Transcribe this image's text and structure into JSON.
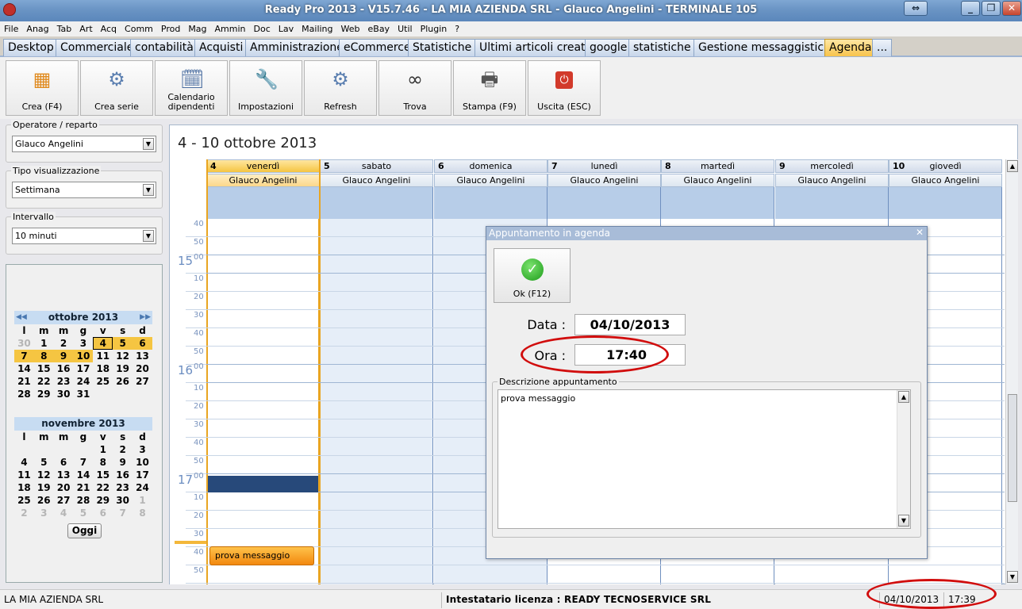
{
  "window": {
    "title": "Ready Pro 2013 - V15.7.46 - LA MIA AZIENDA SRL - Glauco Angelini - TERMINALE 105",
    "buttons": {
      "restore_alt": "⇔",
      "minimize": "_",
      "maximize": "❐",
      "close": "✕"
    }
  },
  "menu": [
    "File",
    "Anag",
    "Tab",
    "Art",
    "Acq",
    "Comm",
    "Prod",
    "Mag",
    "Ammin",
    "Doc",
    "Lav",
    "Mailing",
    "Web",
    "eBay",
    "Util",
    "Plugin",
    "?"
  ],
  "tabs": [
    {
      "label": "Desktop"
    },
    {
      "label": "Commerciale"
    },
    {
      "label": "contabilità"
    },
    {
      "label": "Acquisti"
    },
    {
      "label": "Amministrazione"
    },
    {
      "label": "eCommerce"
    },
    {
      "label": "Statistiche"
    },
    {
      "label": "Ultimi articoli creati"
    },
    {
      "label": "google"
    },
    {
      "label": "statistiche"
    },
    {
      "label": "Gestione messaggistica"
    },
    {
      "label": "Agenda",
      "active": true
    },
    {
      "label": "..."
    }
  ],
  "toolbar": [
    {
      "label": "Crea (F4)",
      "icon": "grid-add-icon"
    },
    {
      "label": "Crea serie",
      "icon": "gear-doc-icon"
    },
    {
      "label": "Calendario dipendenti",
      "icon": "calendar-clock-icon"
    },
    {
      "label": "Impostazioni",
      "icon": "wrench-icon"
    },
    {
      "label": "Refresh",
      "icon": "refresh-doc-icon"
    },
    {
      "label": "Trova",
      "icon": "binoculars-icon"
    },
    {
      "label": "Stampa (F9)",
      "icon": "printer-icon"
    },
    {
      "label": "Uscita (ESC)",
      "icon": "power-icon"
    }
  ],
  "filters": {
    "operatore": {
      "label": "Operatore / reparto",
      "value": "Glauco Angelini"
    },
    "tipo": {
      "label": "Tipo visualizzazione",
      "value": "Settimana"
    },
    "intervallo": {
      "label": "Intervallo",
      "value": "10 minuti"
    }
  },
  "calendar_oct": {
    "title": "ottobre 2013",
    "days_header": [
      "l",
      "m",
      "m",
      "g",
      "v",
      "s",
      "d"
    ],
    "weeks": [
      [
        "30",
        "1",
        "2",
        "3",
        "4",
        "5",
        "6"
      ],
      [
        "7",
        "8",
        "9",
        "10",
        "11",
        "12",
        "13"
      ],
      [
        "14",
        "15",
        "16",
        "17",
        "18",
        "19",
        "20"
      ],
      [
        "21",
        "22",
        "23",
        "24",
        "25",
        "26",
        "27"
      ],
      [
        "28",
        "29",
        "30",
        "31",
        "",
        "",
        ""
      ]
    ]
  },
  "calendar_nov": {
    "title": "novembre 2013",
    "days_header": [
      "l",
      "m",
      "m",
      "g",
      "v",
      "s",
      "d"
    ],
    "weeks": [
      [
        "",
        "",
        "",
        "",
        "1",
        "2",
        "3"
      ],
      [
        "4",
        "5",
        "6",
        "7",
        "8",
        "9",
        "10"
      ],
      [
        "11",
        "12",
        "13",
        "14",
        "15",
        "16",
        "17"
      ],
      [
        "18",
        "19",
        "20",
        "21",
        "22",
        "23",
        "24"
      ],
      [
        "25",
        "26",
        "27",
        "28",
        "29",
        "30",
        "1"
      ],
      [
        "2",
        "3",
        "4",
        "5",
        "6",
        "7",
        "8"
      ]
    ]
  },
  "oggi_label": "Oggi",
  "week_title": "4 - 10 ottobre 2013",
  "days": [
    {
      "num": "4",
      "name": "venerdì",
      "operator": "Glauco Angelini"
    },
    {
      "num": "5",
      "name": "sabato",
      "operator": "Glauco Angelini"
    },
    {
      "num": "6",
      "name": "domenica",
      "operator": "Glauco Angelini"
    },
    {
      "num": "7",
      "name": "lunedì",
      "operator": "Glauco Angelini"
    },
    {
      "num": "8",
      "name": "martedì",
      "operator": "Glauco Angelini"
    },
    {
      "num": "9",
      "name": "mercoledì",
      "operator": "Glauco Angelini"
    },
    {
      "num": "10",
      "name": "giovedì",
      "operator": "Glauco Angelini"
    }
  ],
  "time_rows": [
    {
      "label": "40"
    },
    {
      "label": "50"
    },
    {
      "hour": "15",
      "label": "00"
    },
    {
      "label": "10"
    },
    {
      "label": "20"
    },
    {
      "label": "30"
    },
    {
      "label": "40"
    },
    {
      "label": "50"
    },
    {
      "hour": "16",
      "label": "00"
    },
    {
      "label": "10"
    },
    {
      "label": "20"
    },
    {
      "label": "30"
    },
    {
      "label": "40"
    },
    {
      "label": "50"
    },
    {
      "hour": "17",
      "label": "00"
    },
    {
      "label": "10"
    },
    {
      "label": "20"
    },
    {
      "label": "30"
    },
    {
      "label": "40"
    },
    {
      "label": "50"
    }
  ],
  "event": {
    "text": "prova messaggio"
  },
  "dialog": {
    "title": "Appuntamento in agenda",
    "ok_label": "Ok (F12)",
    "data_label": "Data :",
    "data_value": "04/10/2013",
    "ora_label": "Ora :",
    "ora_value": "17:40",
    "desc_label": "Descrizione appuntamento",
    "desc_value": "prova messaggio"
  },
  "status": {
    "company": "LA MIA AZIENDA SRL",
    "license": "Intestatario licenza : READY TECNOSERVICE SRL",
    "date": "04/10/2013",
    "time": "17:39"
  }
}
